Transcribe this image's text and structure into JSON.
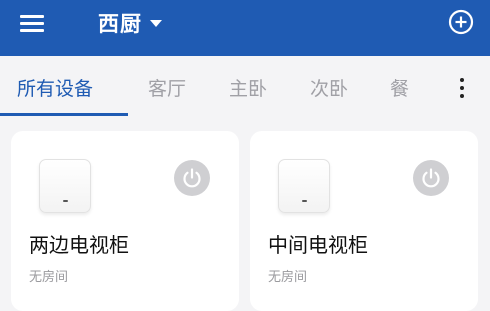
{
  "appbar": {
    "menu_icon": "hamburger-menu-icon",
    "home_name": "西厨",
    "home_dropdown_icon": "caret-down-icon",
    "add_icon": "plus-circle-icon",
    "background": "#1f5bb3"
  },
  "tabs": {
    "items": [
      {
        "label": "所有设备",
        "active": true
      },
      {
        "label": "客厅",
        "active": false
      },
      {
        "label": "主卧",
        "active": false
      },
      {
        "label": "次卧",
        "active": false
      },
      {
        "label": "餐",
        "active": false
      }
    ],
    "more_icon": "more-vertical-icon",
    "active_color": "#1f5bb3",
    "inactive_color": "#a0a0a6"
  },
  "devices": [
    {
      "name": "两边电视柜",
      "room": "无房间",
      "power_icon": "power-icon",
      "image_icon": "router-device-icon"
    },
    {
      "name": "中间电视柜",
      "room": "无房间",
      "power_icon": "power-icon",
      "image_icon": "router-device-icon"
    }
  ]
}
